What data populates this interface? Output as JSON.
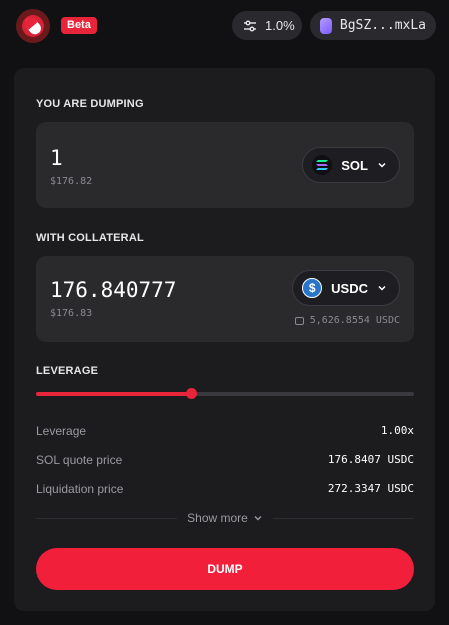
{
  "header": {
    "logo_icon": "pill-logo-icon",
    "badge": "Beta",
    "slippage_icon": "sliders-icon",
    "slippage": "1.0%",
    "wallet_icon": "wallet-icon",
    "wallet_address": "BgSZ...mxLa"
  },
  "dump": {
    "label": "YOU ARE DUMPING",
    "amount": "1",
    "usd_value": "$176.82",
    "token": "SOL",
    "token_icon": "solana-icon"
  },
  "collateral": {
    "label": "WITH COLLATERAL",
    "amount": "176.840777",
    "usd_value": "$176.83",
    "token": "USDC",
    "token_icon": "usdc-icon",
    "balance": "5,626.8554 USDC"
  },
  "leverage": {
    "label": "LEVERAGE",
    "slider_fraction": 0.41
  },
  "details": [
    {
      "label": "Leverage",
      "value": "1.00x"
    },
    {
      "label": "SOL quote price",
      "value": "176.8407 USDC"
    },
    {
      "label": "Liquidation price",
      "value": "272.3347 USDC"
    }
  ],
  "show_more": "Show more",
  "action_button": "DUMP",
  "colors": {
    "accent": "#f21f3b",
    "background": "#111113",
    "card": "#1c1c1f"
  }
}
